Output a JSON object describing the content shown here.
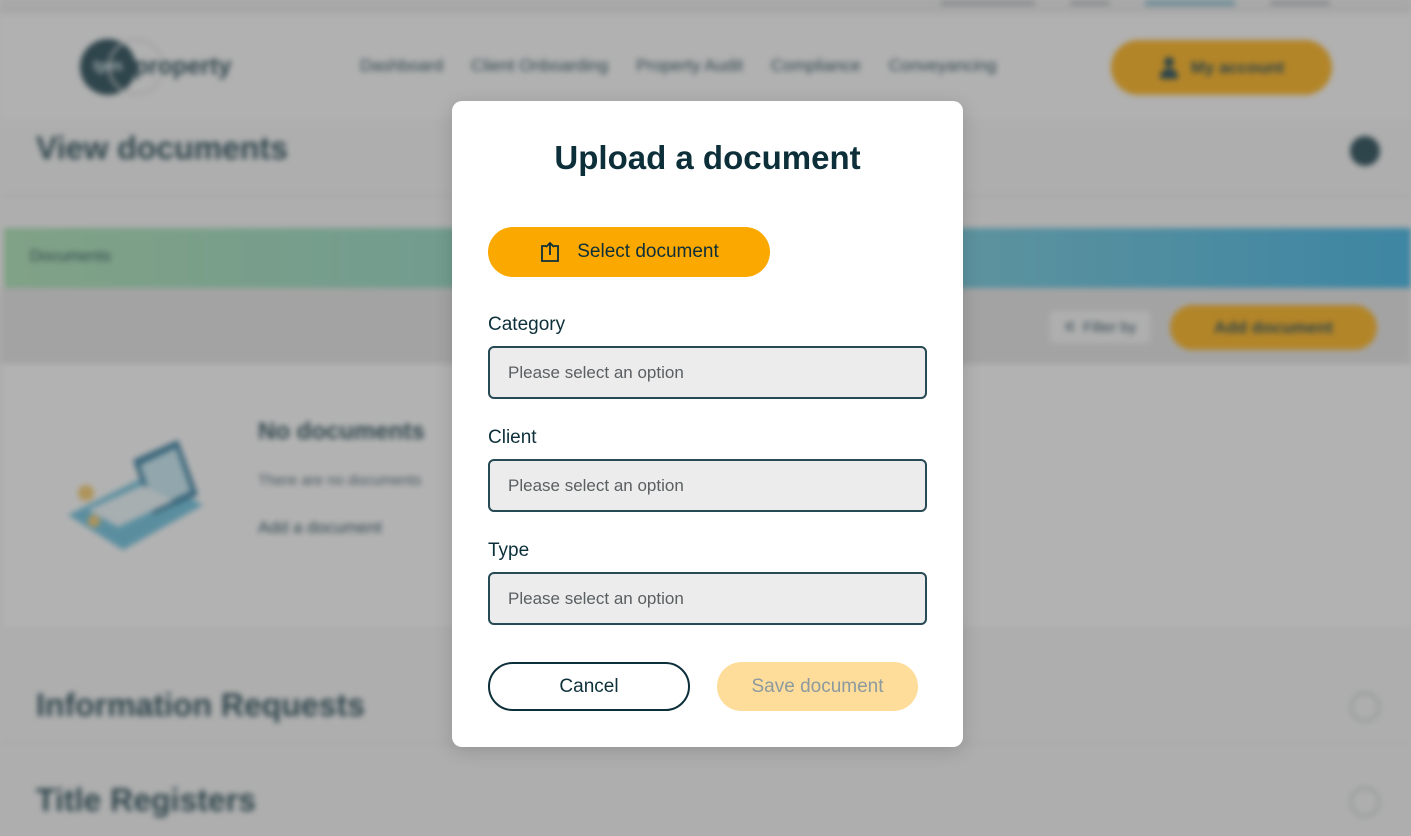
{
  "navbar": {
    "logo_mark": "tpm",
    "logo_text": "property",
    "links": [
      "Dashboard",
      "Client Onboarding",
      "Property Audit",
      "Compliance",
      "Conveyancing"
    ],
    "account_label": "My account"
  },
  "page": {
    "title": "View documents",
    "documents_tab": "Documents",
    "filter_label": "Filter by",
    "add_document_label": "Add document",
    "empty_title": "No documents",
    "empty_text": "There are no documents",
    "add_document_link": "Add a document",
    "sections": [
      "Information Requests",
      "Title Registers"
    ]
  },
  "modal": {
    "title": "Upload a document",
    "select_document_label": "Select document",
    "fields": [
      {
        "label": "Category",
        "placeholder": "Please select an option"
      },
      {
        "label": "Client",
        "placeholder": "Please select an option"
      },
      {
        "label": "Type",
        "placeholder": "Please select an option"
      }
    ],
    "cancel_label": "Cancel",
    "save_label": "Save document",
    "save_enabled": false
  },
  "colors": {
    "primary": "#fba800",
    "primary_disabled": "#fedd9a",
    "text_dark": "#0d2f3a",
    "field_bg": "#ececec",
    "overlay": "rgba(90,90,90,0.45)"
  }
}
